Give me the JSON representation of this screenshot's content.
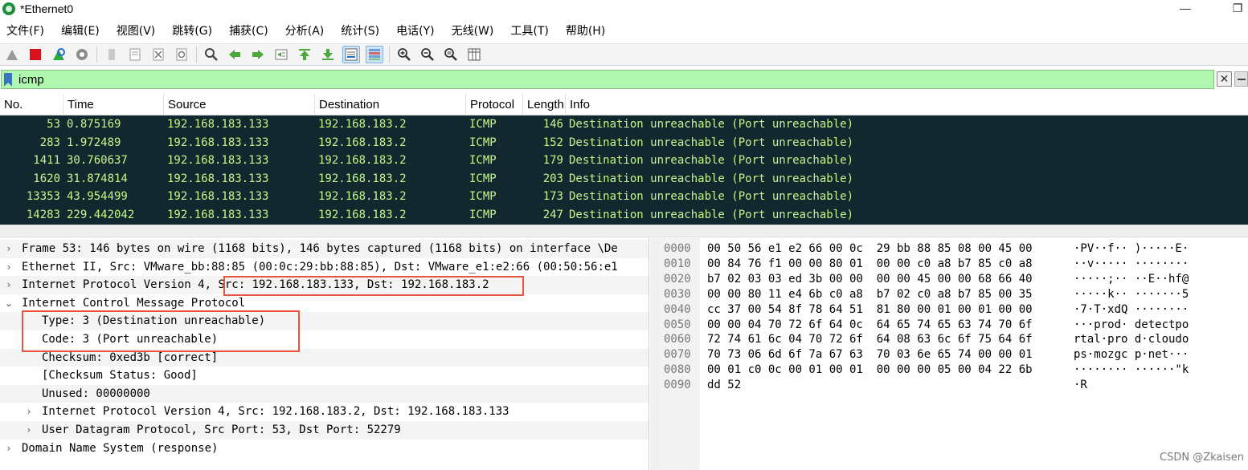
{
  "window": {
    "title": "*Ethernet0",
    "restore_glyph": "❐"
  },
  "menu": [
    "文件(F)",
    "编辑(E)",
    "视图(V)",
    "跳转(G)",
    "捕获(C)",
    "分析(A)",
    "统计(S)",
    "电话(Y)",
    "无线(W)",
    "工具(T)",
    "帮助(H)"
  ],
  "toolbar": {
    "icons": [
      "shark-fin-start-icon",
      "stop-capture-icon",
      "restart-capture-icon",
      "capture-options-icon",
      "open-file-icon",
      "save-file-icon",
      "close-file-icon",
      "reload-file-icon",
      "find-packet-icon",
      "go-back-icon",
      "go-forward-icon",
      "go-to-packet-icon",
      "go-first-icon",
      "go-last-icon",
      "auto-scroll-icon",
      "colorize-icon",
      "zoom-in-icon",
      "zoom-out-icon",
      "normal-size-icon",
      "resize-columns-icon"
    ]
  },
  "filter": {
    "value": "icmp",
    "clear_glyph": "✕"
  },
  "packet_list": {
    "columns": [
      "No.",
      "Time",
      "Source",
      "Destination",
      "Protocol",
      "Length",
      "Info"
    ],
    "rows": [
      [
        "53",
        "0.875169",
        "192.168.183.133",
        "192.168.183.2",
        "ICMP",
        "146",
        "Destination unreachable (Port unreachable)"
      ],
      [
        "283",
        "1.972489",
        "192.168.183.133",
        "192.168.183.2",
        "ICMP",
        "152",
        "Destination unreachable (Port unreachable)"
      ],
      [
        "1411",
        "30.760637",
        "192.168.183.133",
        "192.168.183.2",
        "ICMP",
        "179",
        "Destination unreachable (Port unreachable)"
      ],
      [
        "1620",
        "31.874814",
        "192.168.183.133",
        "192.168.183.2",
        "ICMP",
        "203",
        "Destination unreachable (Port unreachable)"
      ],
      [
        "13353",
        "43.954499",
        "192.168.183.133",
        "192.168.183.2",
        "ICMP",
        "173",
        "Destination unreachable (Port unreachable)"
      ],
      [
        "14283",
        "229.442042",
        "192.168.183.133",
        "192.168.183.2",
        "ICMP",
        "247",
        "Destination unreachable (Port unreachable)"
      ]
    ],
    "row_text_color": "#c3f78c",
    "row_bg_color": "#12272e"
  },
  "details": {
    "rows": [
      {
        "arrow": "›",
        "text": "Frame 53: 146 bytes on wire (1168 bits), 146 bytes captured (1168 bits) on interface \\De"
      },
      {
        "arrow": "›",
        "text": "Ethernet II, Src: VMware_bb:88:85 (00:0c:29:bb:88:85), Dst: VMware_e1:e2:66 (00:50:56:e1"
      },
      {
        "arrow": "›",
        "text": "Internet Protocol Version 4, ",
        "text2": "Src: 192.168.183.133, Dst: 192.168.183.2"
      },
      {
        "arrow": "⌄",
        "text": "Internet Control Message Protocol"
      },
      {
        "arrow": "",
        "text": "Type: 3 (Destination unreachable)"
      },
      {
        "arrow": "",
        "text": "Code: 3 (Port unreachable)"
      },
      {
        "arrow": "",
        "text": "Checksum: 0xed3b [correct]"
      },
      {
        "arrow": "",
        "text": "[Checksum Status: Good]"
      },
      {
        "arrow": "",
        "text": "Unused: 00000000"
      },
      {
        "arrow": "›",
        "text": "Internet Protocol Version 4, Src: 192.168.183.2, Dst: 192.168.183.133"
      },
      {
        "arrow": "›",
        "text": "User Datagram Protocol, Src Port: 53, Dst Port: 52279"
      },
      {
        "arrow": "›",
        "text": "Domain Name System (response)"
      }
    ],
    "highlight_color": "#e8543e"
  },
  "hex": {
    "rows": [
      {
        "offset": "0000",
        "bytes": "00 50 56 e1 e2 66 00 0c  29 bb 88 85 08 00 45 00",
        "ascii": "·PV··f·· )·····E·"
      },
      {
        "offset": "0010",
        "bytes": "00 84 76 f1 00 00 80 01  00 00 c0 a8 b7 85 c0 a8",
        "ascii": "··v····· ········"
      },
      {
        "offset": "0020",
        "bytes": "b7 02 03 03 ed 3b 00 00  00 00 45 00 00 68 66 40",
        "ascii": "·····;·· ··E··hf@"
      },
      {
        "offset": "0030",
        "bytes": "00 00 80 11 e4 6b c0 a8  b7 02 c0 a8 b7 85 00 35",
        "ascii": "·····k·· ·······5"
      },
      {
        "offset": "0040",
        "bytes": "cc 37 00 54 8f 78 64 51  81 80 00 01 00 01 00 00",
        "ascii": "·7·T·xdQ ········"
      },
      {
        "offset": "0050",
        "bytes": "00 00 04 70 72 6f 64 0c  64 65 74 65 63 74 70 6f",
        "ascii": "···prod· detectpo"
      },
      {
        "offset": "0060",
        "bytes": "72 74 61 6c 04 70 72 6f  64 08 63 6c 6f 75 64 6f",
        "ascii": "rtal·pro d·cloudo"
      },
      {
        "offset": "0070",
        "bytes": "70 73 06 6d 6f 7a 67 63  70 03 6e 65 74 00 00 01",
        "ascii": "ps·mozgc p·net···"
      },
      {
        "offset": "0080",
        "bytes": "00 01 c0 0c 00 01 00 01  00 00 00 05 00 04 22 6b",
        "ascii": "········ ······\"k"
      },
      {
        "offset": "0090",
        "bytes": "dd 52",
        "ascii": "·R"
      }
    ]
  },
  "watermark": "CSDN @Zkaisen"
}
